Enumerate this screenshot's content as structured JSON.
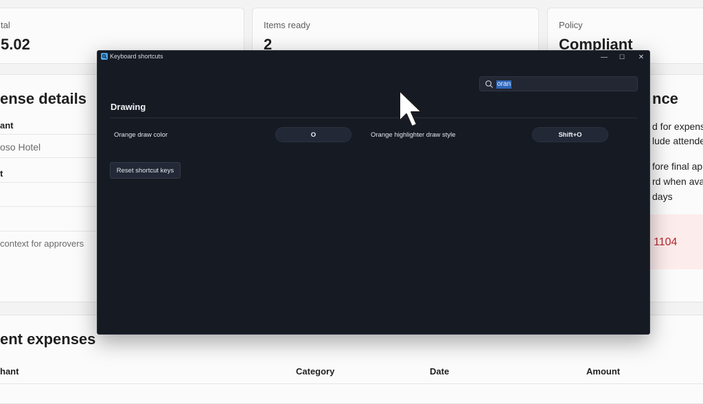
{
  "summary_cards": [
    {
      "label": "tal",
      "value": "5.02"
    },
    {
      "label": "Items ready",
      "value": "2"
    },
    {
      "label": "Policy",
      "value": "Compliant"
    }
  ],
  "details": {
    "title": "ense details",
    "rows": [
      {
        "text": "ant"
      },
      {
        "text": "oso Hotel"
      },
      {
        "text": "t"
      },
      {
        "text": "context for approvers"
      }
    ]
  },
  "guidance": {
    "title": "nce",
    "lines": [
      "d for expens",
      "lude attende",
      "fore final ap",
      "rd when ava",
      "days"
    ],
    "alert_value": "1104"
  },
  "recent": {
    "title": "ent expenses",
    "columns": [
      "hant",
      "Category",
      "Date",
      "Amount"
    ]
  },
  "dialog": {
    "title": "Keyboard shortcuts",
    "search": {
      "value": "oran",
      "placeholder": "Search"
    },
    "group": "Drawing",
    "shortcuts": [
      {
        "label": "Orange draw color",
        "key": "O"
      },
      {
        "label": "Orange highlighter draw style",
        "key": "Shift+O"
      }
    ],
    "reset_label": "Reset shortcut keys",
    "controls": {
      "minimize": "—",
      "maximize": "☐",
      "close": "✕"
    }
  }
}
